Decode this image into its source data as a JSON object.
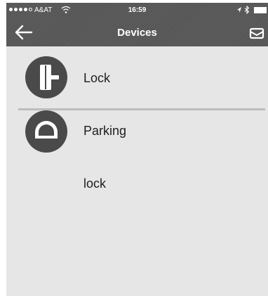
{
  "status_bar": {
    "carrier": "A&AT",
    "time": "16:59",
    "wifi_icon": "wifi-icon",
    "bluetooth_icon": "bluetooth-icon",
    "location_icon": "location-arrow-icon",
    "battery_icon": "battery-icon"
  },
  "nav": {
    "title": "Devices",
    "back_icon": "arrow-left-icon",
    "mail_icon": "envelope-icon"
  },
  "devices": [
    {
      "label": "Lock",
      "icon": "door-lock-icon"
    },
    {
      "label": "Parking",
      "icon": "parking-lock-icon"
    },
    {
      "label": "lock"
    }
  ],
  "colors": {
    "header_bg": "#555555",
    "page_bg": "#e6e6e6",
    "icon_bg": "#4a4a4a",
    "divider": "#bdbdbd",
    "text": "#1e1e1e"
  }
}
